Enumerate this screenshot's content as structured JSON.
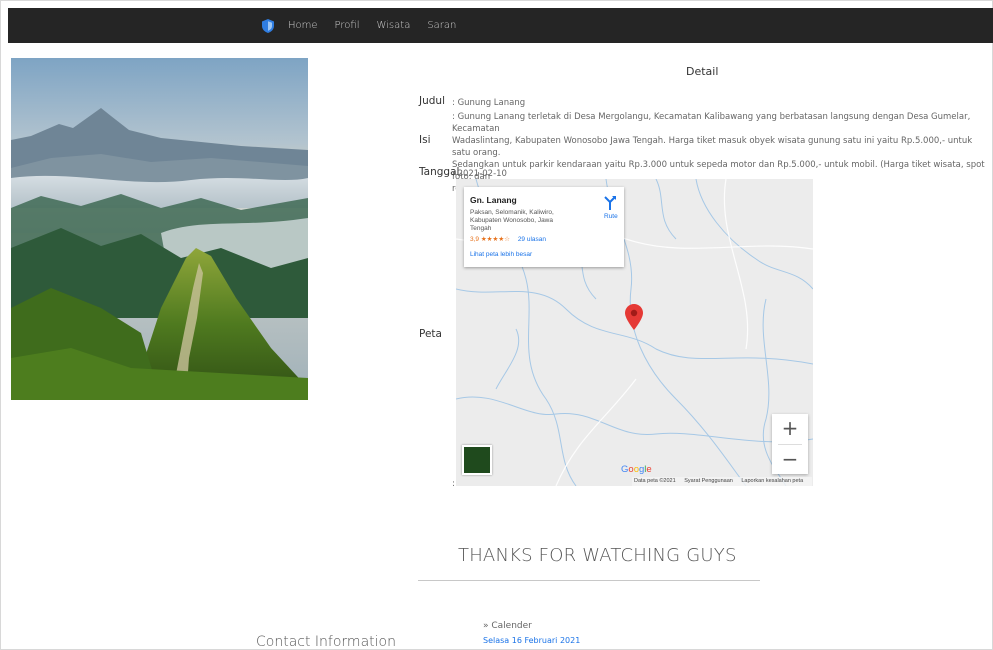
{
  "nav": {
    "items": [
      "Home",
      "Profil",
      "Wisata",
      "Saran"
    ]
  },
  "detail": {
    "heading": "Detail",
    "judul_label": "Judul",
    "judul_value": ": Gunung Lanang",
    "isi_label": "Isi",
    "isi_lines": [
      ": Gunung Lanang terletak di Desa Mergolangu, Kecamatan Kalibawang yang berbatasan langsung dengan Desa Gumelar, Kecamatan",
      "Wadaslintang, Kabupaten Wonosobo Jawa Tengah. Harga tiket masuk obyek wisata gunung satu ini yaitu Rp.5.000,- untuk satu orang.",
      "Sedangkan untuk parkir kendaraan yaitu Rp.3.000 untuk sepeda motor dan Rp.5.000,- untuk mobil. (Harga tiket wisata, spot foto, dan",
      "retribusi bisa berubah sewaktu-waktu)"
    ],
    "tanggal_label": "Tanggal",
    "tanggal_value": ": 2021-02-10",
    "peta_label": "Peta",
    "peta_colon": ":"
  },
  "map": {
    "place_name": "Gn. Lanang",
    "address": "Paksan, Selomanik, Kaliwiro, Kabupaten Wonosobo, Jawa Tengah",
    "rating": "3,9",
    "stars": "★★★★☆",
    "reviews": "29 ulasan",
    "more_link": "Lihat peta lebih besar",
    "directions": "Rute",
    "zoom_in": "+",
    "zoom_out": "−",
    "logo": "Google",
    "footer": [
      "Data peta ©2021",
      "Syarat Penggunaan",
      "Laporkan kesalahan peta"
    ]
  },
  "footer": {
    "thanks": "THANKS FOR WATCHING GUYS",
    "contact": "Contact Information",
    "calendar_label": "» Calender",
    "calendar_date": "Selasa 16 Februari 2021"
  },
  "colors": {
    "navbar": "#252525",
    "link_blue": "#1a73e8",
    "pin_red": "#e53935"
  }
}
